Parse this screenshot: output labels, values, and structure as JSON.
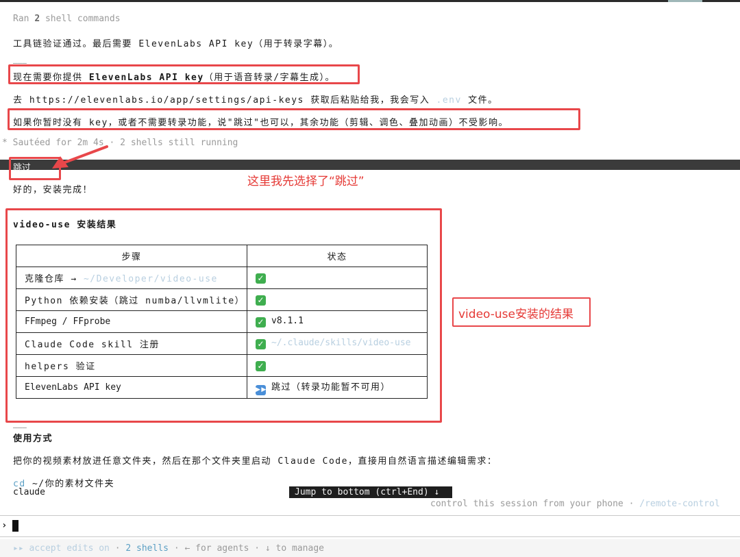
{
  "header": {
    "ran_prefix": "Ran ",
    "ran_count": "2",
    "ran_suffix": " shell commands"
  },
  "messages": {
    "toolchain_ok": "工具链验证通过。最后需要 ElevenLabs API key（用于转录字幕）。",
    "divider1": "___",
    "need_key_prefix": "现在需要你提供 ",
    "need_key_bold": "ElevenLabs API key",
    "need_key_suffix": "（用于语音转录/字幕生成）。",
    "goto_prefix": "去 https://elevenlabs.io/app/settings/api-keys 获取后粘贴给我，我会写入 ",
    "goto_env": ".env",
    "goto_suffix": " 文件。",
    "no_key": "如果你暂时没有 key，或者不需要转录功能，说\"跳过\"也可以，其余功能（剪辑、调色、叠加动画）不受影响。",
    "sauteed": "* Sautéed for 2m 4s · 2 shells still running",
    "user_input": "跳过",
    "done": "好的，安装完成！",
    "result_title": "video-use 安装结果",
    "divider2": "___",
    "usage_title": "使用方式",
    "usage_desc": "把你的视频素材放进任意文件夹，然后在那个文件夹里启动 Claude Code，直接用自然语言描述编辑需求：",
    "code_cd": "cd",
    "code_path": " ~/你的素材文件夹",
    "code_claude": "claude"
  },
  "annotations": {
    "skip_note": "这里我先选择了“跳过”",
    "result_note": "video-use安装的结果"
  },
  "table": {
    "headers": [
      "步骤",
      "状态"
    ],
    "rows": [
      {
        "step": "克隆仓库 → ",
        "step_path": "~/Developer/video-use",
        "status_icon": "check",
        "status_text": "",
        "status_path": ""
      },
      {
        "step": "Python 依赖安装（跳过 numba/llvmlite）",
        "step_path": "",
        "status_icon": "check",
        "status_text": "",
        "status_path": ""
      },
      {
        "step": "FFmpeg / FFprobe",
        "step_path": "",
        "status_icon": "check",
        "status_text": "v8.1.1",
        "status_path": ""
      },
      {
        "step": "Claude Code skill 注册",
        "step_path": "",
        "status_icon": "check",
        "status_text": "",
        "status_path": "~/.claude/skills/video-use"
      },
      {
        "step": "helpers 验证",
        "step_path": "",
        "status_icon": "check",
        "status_text": "",
        "status_path": ""
      },
      {
        "step": "ElevenLabs API key",
        "step_path": "",
        "status_icon": "skip",
        "status_text": "跳过（转录功能暂不可用）",
        "status_path": ""
      }
    ]
  },
  "overlay": {
    "jump_label": "Jump to bottom (ctrl+End) ↓",
    "remote_prefix": "control this session from your phone · ",
    "remote_cmd": "/remote-control"
  },
  "prompt": {
    "chevron": "›"
  },
  "statusbar": {
    "mode_icon": "▸▸",
    "mode_text": " accept edits on",
    "sep1": " · ",
    "shells": "2 shells",
    "sep2": " · ",
    "agents": "← for agents",
    "sep3": " · ",
    "manage": "↓ to manage"
  },
  "colors": {
    "annotation_red": "#e8474a",
    "link_light_blue": "#b8cfe0",
    "code_cyan": "#5b9fc4",
    "check_green": "#3fae4f"
  }
}
